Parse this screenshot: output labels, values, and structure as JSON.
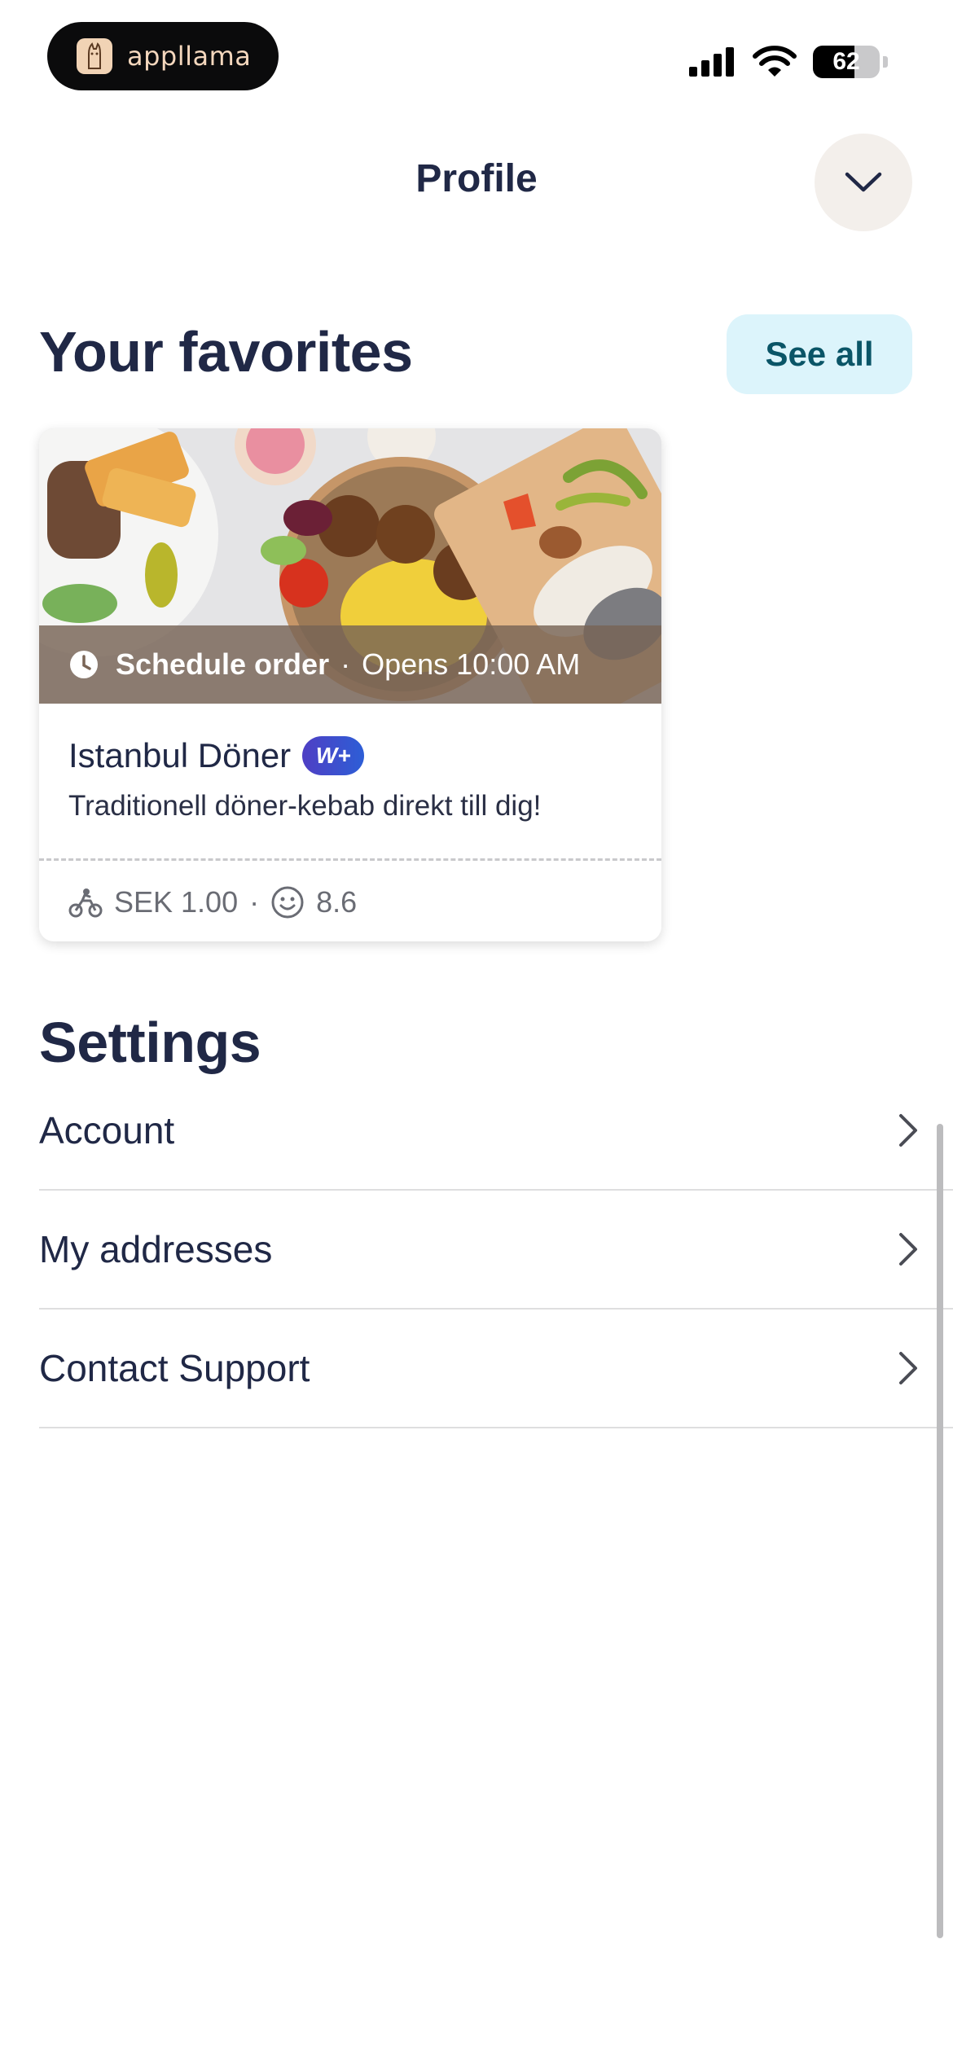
{
  "status_bar": {
    "brand": "appllama",
    "battery": "62",
    "battery_level": 0.62
  },
  "header": {
    "title": "Profile",
    "collapse_icon": "chevron-down-icon"
  },
  "favorites": {
    "title": "Your favorites",
    "see_all_label": "See all",
    "cards": [
      {
        "schedule_label": "Schedule order",
        "separator": "·",
        "opens_text": "Opens 10:00 AM",
        "name": "Istanbul Döner",
        "badge": "W+",
        "description": "Traditionell döner-kebab direkt till dig!",
        "delivery_fee": "SEK 1.00",
        "meta_separator": "·",
        "rating": "8.6"
      }
    ]
  },
  "settings": {
    "title": "Settings",
    "items": [
      {
        "label": "Account"
      },
      {
        "label": "My addresses"
      },
      {
        "label": "Contact Support"
      }
    ]
  },
  "colors": {
    "heading": "#202846",
    "see_all_bg": "#dcf4fb",
    "see_all_text": "#0a5567",
    "collapse_bg": "#f3efeb"
  }
}
